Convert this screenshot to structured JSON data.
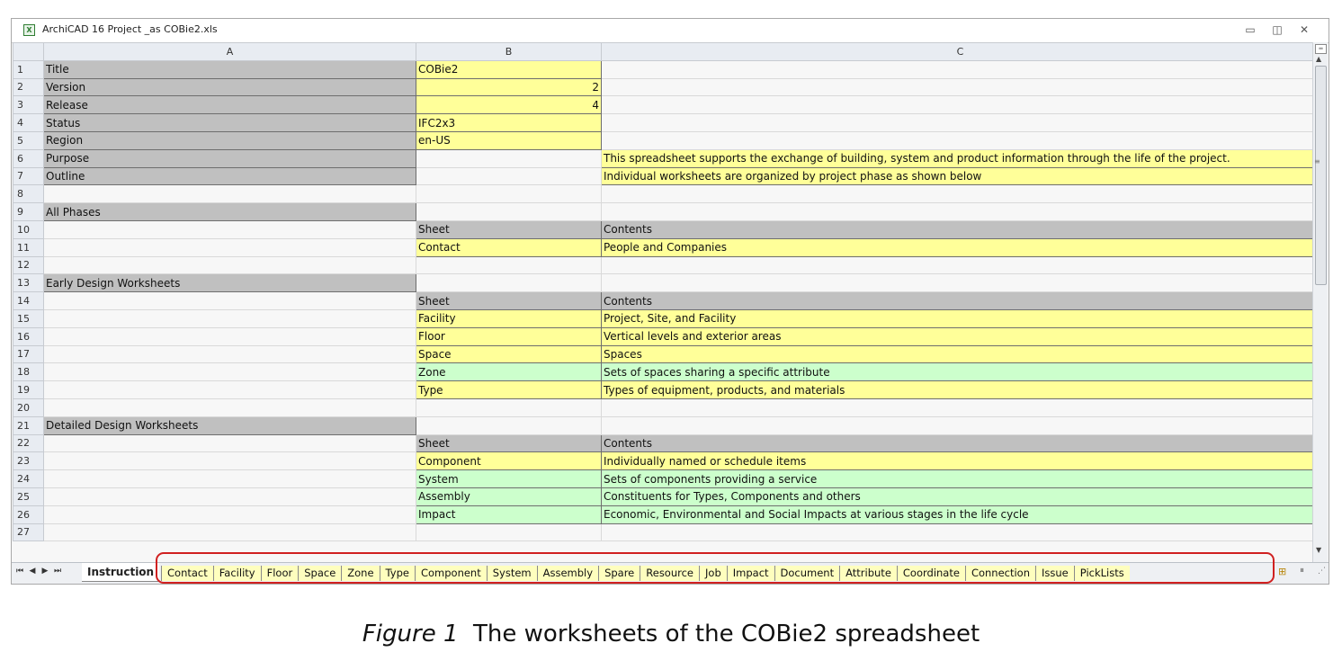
{
  "window": {
    "title": "ArchiCAD 16 Project _as COBie2.xls",
    "minimize_glyph": "▭",
    "restore_glyph": "◫",
    "close_glyph": "✕"
  },
  "sheet": {
    "column_headers": [
      "A",
      "B",
      "C"
    ],
    "rows": [
      {
        "n": "1",
        "a": "Title",
        "b": "COBie2",
        "c": "",
        "ac": "gray",
        "bc": "yellow",
        "cc": ""
      },
      {
        "n": "2",
        "a": "Version",
        "b": "2",
        "c": "",
        "ac": "gray",
        "bc": "yellow num",
        "cc": ""
      },
      {
        "n": "3",
        "a": "Release",
        "b": "4",
        "c": "",
        "ac": "gray",
        "bc": "yellow num",
        "cc": ""
      },
      {
        "n": "4",
        "a": "Status",
        "b": "IFC2x3",
        "c": "",
        "ac": "gray",
        "bc": "yellow",
        "cc": ""
      },
      {
        "n": "5",
        "a": "Region",
        "b": "en-US",
        "c": "",
        "ac": "gray",
        "bc": "yellow",
        "cc": ""
      },
      {
        "n": "6",
        "a": "Purpose",
        "b": "",
        "c": "This spreadsheet supports the exchange of building, system and product information through the life of the project.",
        "ac": "gray",
        "bc": "",
        "cc": "yellow"
      },
      {
        "n": "7",
        "a": "Outline",
        "b": "",
        "c": "Individual worksheets are organized by project phase as shown below",
        "ac": "gray",
        "bc": "",
        "cc": "yellow"
      },
      {
        "n": "8",
        "a": "",
        "b": "",
        "c": "",
        "ac": "",
        "bc": "",
        "cc": ""
      },
      {
        "n": "9",
        "a": "All Phases",
        "b": "",
        "c": "",
        "ac": "gray",
        "bc": "",
        "cc": ""
      },
      {
        "n": "10",
        "a": "",
        "b": "Sheet",
        "c": "Contents",
        "ac": "",
        "bc": "gray",
        "cc": "gray"
      },
      {
        "n": "11",
        "a": "",
        "b": "Contact",
        "c": "People and Companies",
        "ac": "",
        "bc": "yellow",
        "cc": "yellow"
      },
      {
        "n": "12",
        "a": "",
        "b": "",
        "c": "",
        "ac": "",
        "bc": "",
        "cc": ""
      },
      {
        "n": "13",
        "a": "Early Design Worksheets",
        "b": "",
        "c": "",
        "ac": "gray",
        "bc": "",
        "cc": ""
      },
      {
        "n": "14",
        "a": "",
        "b": "Sheet",
        "c": "Contents",
        "ac": "",
        "bc": "gray",
        "cc": "gray"
      },
      {
        "n": "15",
        "a": "",
        "b": "Facility",
        "c": "Project, Site, and Facility",
        "ac": "",
        "bc": "yellow",
        "cc": "yellow"
      },
      {
        "n": "16",
        "a": "",
        "b": "Floor",
        "c": "Vertical levels and exterior areas",
        "ac": "",
        "bc": "yellow",
        "cc": "yellow"
      },
      {
        "n": "17",
        "a": "",
        "b": "Space",
        "c": "Spaces",
        "ac": "",
        "bc": "yellow",
        "cc": "yellow"
      },
      {
        "n": "18",
        "a": "",
        "b": "Zone",
        "c": "Sets of spaces sharing a specific attribute",
        "ac": "",
        "bc": "green",
        "cc": "green"
      },
      {
        "n": "19",
        "a": "",
        "b": "Type",
        "c": "Types of equipment, products, and materials",
        "ac": "",
        "bc": "yellow",
        "cc": "yellow"
      },
      {
        "n": "20",
        "a": "",
        "b": "",
        "c": "",
        "ac": "",
        "bc": "",
        "cc": ""
      },
      {
        "n": "21",
        "a": "Detailed Design Worksheets",
        "b": "",
        "c": "",
        "ac": "gray",
        "bc": "",
        "cc": ""
      },
      {
        "n": "22",
        "a": "",
        "b": "Sheet",
        "c": "Contents",
        "ac": "",
        "bc": "gray",
        "cc": "gray"
      },
      {
        "n": "23",
        "a": "",
        "b": "Component",
        "c": "Individually named or schedule items",
        "ac": "",
        "bc": "yellow",
        "cc": "yellow"
      },
      {
        "n": "24",
        "a": "",
        "b": "System",
        "c": "Sets of components providing a service",
        "ac": "",
        "bc": "green",
        "cc": "green"
      },
      {
        "n": "25",
        "a": "",
        "b": "Assembly",
        "c": "Constituents for Types, Components and others",
        "ac": "",
        "bc": "green",
        "cc": "green"
      },
      {
        "n": "26",
        "a": "",
        "b": "Impact",
        "c": "Economic, Environmental and Social Impacts at various stages in the life cycle",
        "ac": "",
        "bc": "green",
        "cc": "green"
      },
      {
        "n": "27",
        "a": "",
        "b": "",
        "c": "",
        "ac": "",
        "bc": "",
        "cc": ""
      }
    ]
  },
  "tabs": {
    "nav": [
      "⏮",
      "◀",
      "▶",
      "⏭"
    ],
    "active": "Instruction",
    "items": [
      "Contact",
      "Facility",
      "Floor",
      "Space",
      "Zone",
      "Type",
      "Component",
      "System",
      "Assembly",
      "Spare",
      "Resource",
      "Job",
      "Impact",
      "Document",
      "Attribute",
      "Coordinate",
      "Connection",
      "Issue",
      "PickLists"
    ]
  },
  "caption": {
    "figure": "Figure 1",
    "text": "The worksheets of the COBie2 spreadsheet"
  },
  "colors": {
    "gray_cell": "#c0c0c0",
    "yellow_cell": "#ffff99",
    "green_cell": "#ccffcc",
    "highlight": "#d02020"
  }
}
